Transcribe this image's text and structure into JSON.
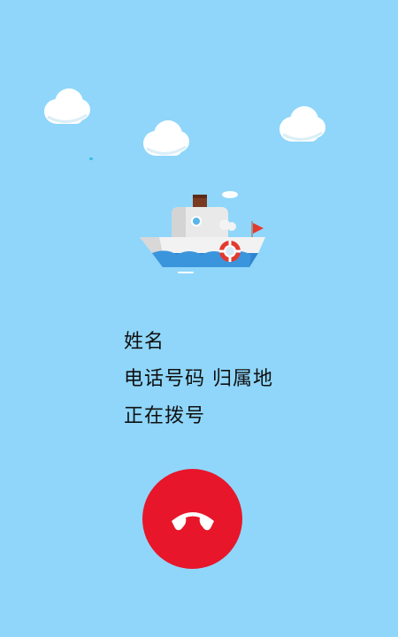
{
  "call": {
    "name": "姓名",
    "number_location": "电话号码 归属地",
    "status": "正在拨号"
  },
  "controls": {
    "hangup_icon": "phone-hangup-icon"
  },
  "theme": {
    "background": "#8fd6fa",
    "hangup_color": "#e8162a",
    "text_color": "#111111"
  }
}
